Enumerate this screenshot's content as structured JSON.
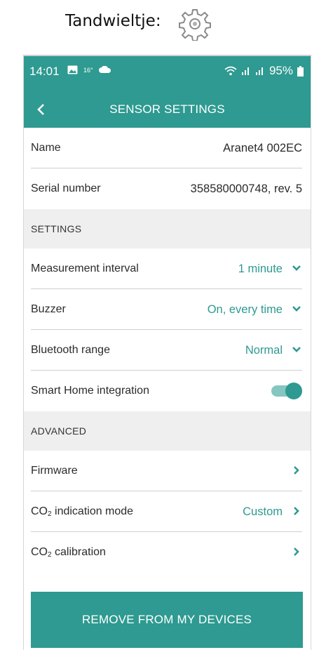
{
  "caption": {
    "label": "Tandwieltje:",
    "icon": "gear-icon"
  },
  "status_bar": {
    "time": "14:01",
    "temp": "16°",
    "battery": "95%",
    "icons": [
      "image-icon",
      "cloud-icon",
      "wifi-icon",
      "signal-icon",
      "signal-icon",
      "battery-icon"
    ]
  },
  "app_bar": {
    "title": "SENSOR SETTINGS",
    "back_icon": "chevron-left-icon"
  },
  "info": {
    "name_label": "Name",
    "name_value": "Aranet4 002EC",
    "serial_label": "Serial number",
    "serial_value": "358580000748, rev. 5"
  },
  "settings": {
    "header": "SETTINGS",
    "measurement_interval_label": "Measurement interval",
    "measurement_interval_value": "1 minute",
    "buzzer_label": "Buzzer",
    "buzzer_value": "On, every time",
    "bluetooth_range_label": "Bluetooth range",
    "bluetooth_range_value": "Normal",
    "smart_home_label": "Smart Home integration",
    "smart_home_enabled": true
  },
  "advanced": {
    "header": "ADVANCED",
    "firmware_label": "Firmware",
    "co2_mode_label_prefix": "CO",
    "co2_mode_label_sub": "2",
    "co2_mode_label_suffix": " indication mode",
    "co2_mode_value": "Custom",
    "co2_calibration_label_prefix": "CO",
    "co2_calibration_label_sub": "2",
    "co2_calibration_label_suffix": " calibration"
  },
  "actions": {
    "remove_label": "REMOVE FROM MY DEVICES"
  },
  "colors": {
    "accent": "#2e9a91",
    "section_bg": "#efefef",
    "toggle_track": "#86c6c1"
  }
}
